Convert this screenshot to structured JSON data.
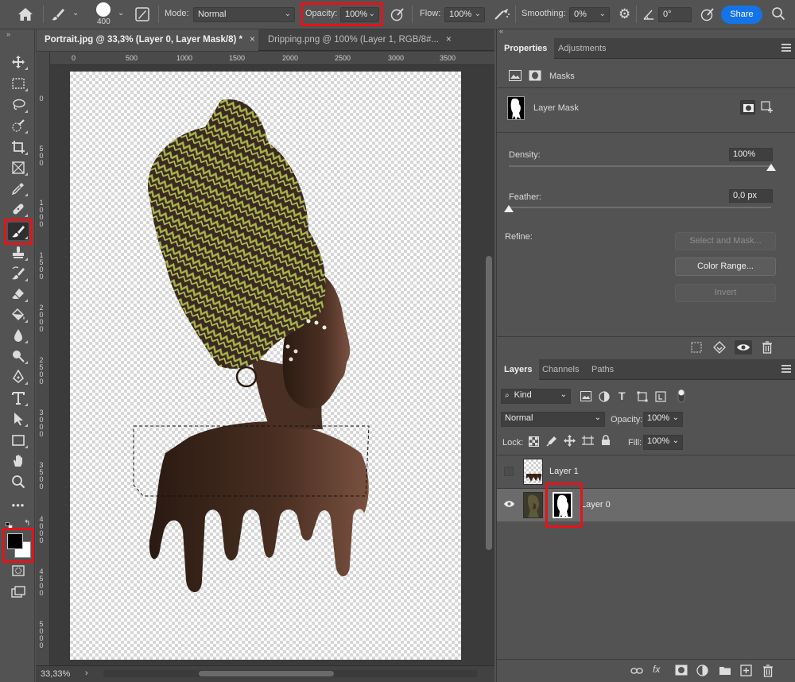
{
  "options_bar": {
    "brush_size": "400",
    "mode_label": "Mode:",
    "mode_value": "Normal",
    "opacity_label": "Opacity:",
    "opacity_value": "100%",
    "flow_label": "Flow:",
    "flow_value": "100%",
    "smoothing_label": "Smoothing:",
    "smoothing_value": "0%",
    "angle_value": "0°",
    "share_label": "Share"
  },
  "document": {
    "tabs": [
      {
        "label": "Portrait.jpg @ 33,3% (Layer 0, Layer Mask/8) *",
        "close": "×"
      },
      {
        "label": "Dripping.png @ 100% (Layer 1, RGB/8#...",
        "close": "×"
      }
    ],
    "ruler_h": [
      "0",
      "500",
      "1000",
      "1500",
      "2000",
      "2500",
      "3000",
      "3500"
    ],
    "ruler_v": [
      "0",
      "500",
      "1000",
      "1500",
      "2000",
      "2500",
      "3000",
      "3500",
      "4000",
      "4500",
      "5000"
    ],
    "zoom": "33,33%"
  },
  "properties": {
    "tabs": [
      "Properties",
      "Adjustments"
    ],
    "section": "Masks",
    "mask_name": "Layer Mask",
    "density_label": "Density:",
    "density_value": "100%",
    "density_level": 1.0,
    "feather_label": "Feather:",
    "feather_value": "0,0 px",
    "feather_level": 0.0,
    "refine_label": "Refine:",
    "select_mask_label": "Select and Mask...",
    "color_range_label": "Color Range...",
    "invert_label": "Invert"
  },
  "layers": {
    "tabs": [
      "Layers",
      "Channels",
      "Paths"
    ],
    "filter_value": "Kind",
    "blend_value": "Normal",
    "opacity_label": "Opacity:",
    "opacity_value": "100%",
    "lock_label": "Lock:",
    "fill_label": "Fill:",
    "fill_value": "100%",
    "items": [
      {
        "name": "Layer 1",
        "visible": false
      },
      {
        "name": "Layer 0",
        "visible": true
      }
    ]
  },
  "colors": {
    "accent": "#1473e6",
    "highlight": "#e3141b"
  }
}
